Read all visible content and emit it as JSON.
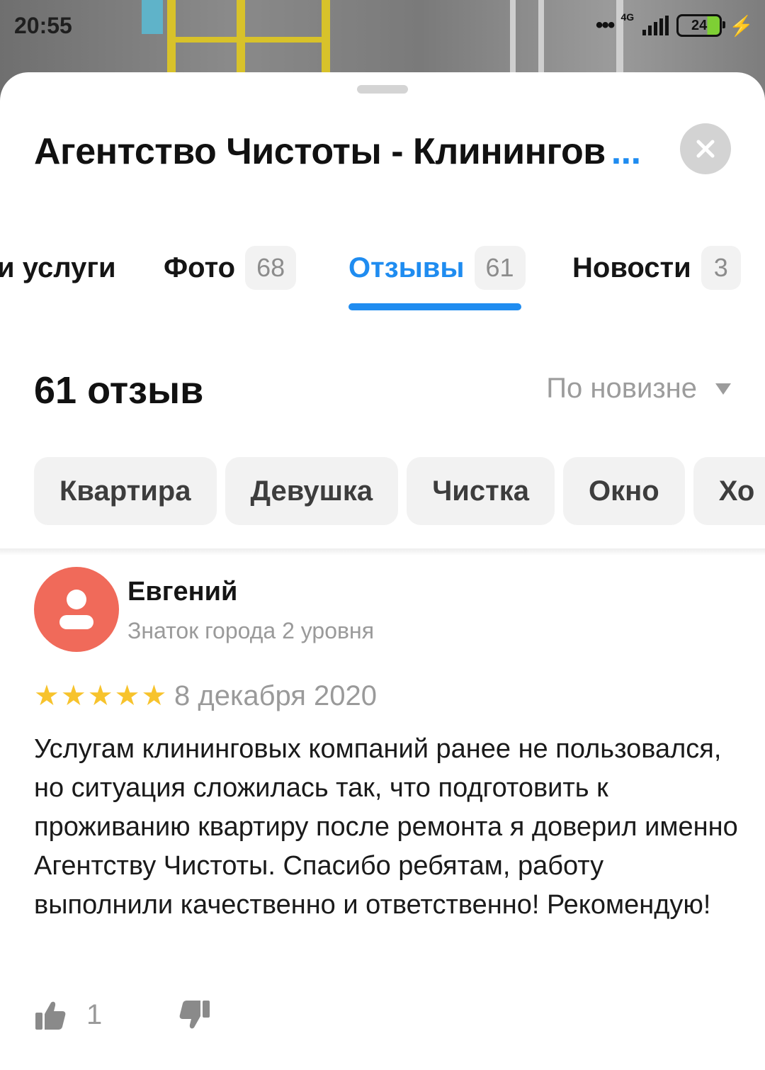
{
  "status_bar": {
    "time": "20:55",
    "network": "4G",
    "battery": "24"
  },
  "header": {
    "title": "Агентство Чистоты - Клинингов",
    "more": "...",
    "close_icon": "close-icon"
  },
  "tabs": [
    {
      "label": "и услуги",
      "count": ""
    },
    {
      "label": "Фото",
      "count": "68"
    },
    {
      "label": "Отзывы",
      "count": "61",
      "active": true
    },
    {
      "label": "Новости",
      "count": "3"
    }
  ],
  "reviews": {
    "heading": "61 отзыв",
    "sort_label": "По новизне",
    "chips": [
      "Квартира",
      "Девушка",
      "Чистка",
      "Окно",
      "Хо"
    ]
  },
  "review": {
    "author": "Евгений",
    "level": "Знаток города 2 уровня",
    "rating": 5,
    "date": "8 декабря 2020",
    "text": "Услугам клининговых компаний ранее не пользовался, но ситуация сложилась так, что подготовить к проживанию квартиру после ремонта я доверил именно Агентству Чистоты. Спасибо ребятам, работу выполнили качественно и ответственно! Рекомендую!",
    "likes": "1"
  },
  "colors": {
    "accent": "#1f8cf0",
    "avatar": "#f06a5a",
    "star": "#f7c32c"
  }
}
